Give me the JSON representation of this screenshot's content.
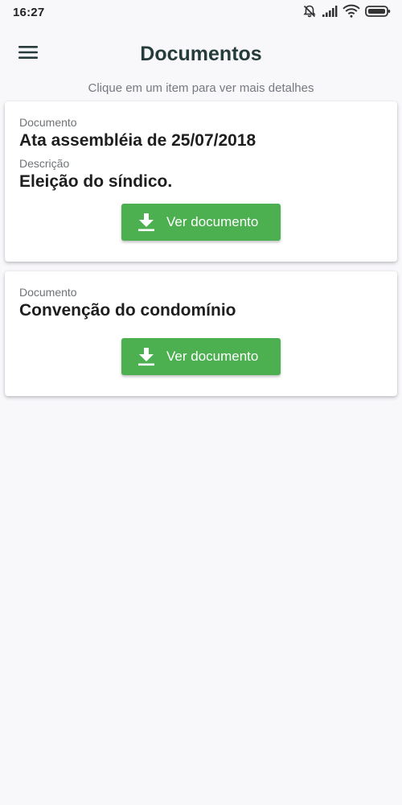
{
  "status_bar": {
    "time": "16:27",
    "icons": [
      "alarm-off-icon",
      "signal-icon",
      "wifi-icon",
      "battery-icon"
    ]
  },
  "app_bar": {
    "title": "Documentos",
    "menu_icon": "hamburger-menu-icon"
  },
  "subtitle": "Clique em um item para ver mais detalhes",
  "documents": [
    {
      "document_label": "Documento",
      "document_name": "Ata assembléia de 25/07/2018",
      "description_label": "Descrição",
      "description": "Eleição do síndico.",
      "button_label": "Ver documento",
      "button_icon": "download-icon"
    },
    {
      "document_label": "Documento",
      "document_name": "Convenção do condomínio",
      "button_label": "Ver documento",
      "button_icon": "download-icon"
    }
  ],
  "colors": {
    "background": "#f8f7fa",
    "accent_button": "#4caf50",
    "title": "#263c3a",
    "label": "#6f7377"
  }
}
